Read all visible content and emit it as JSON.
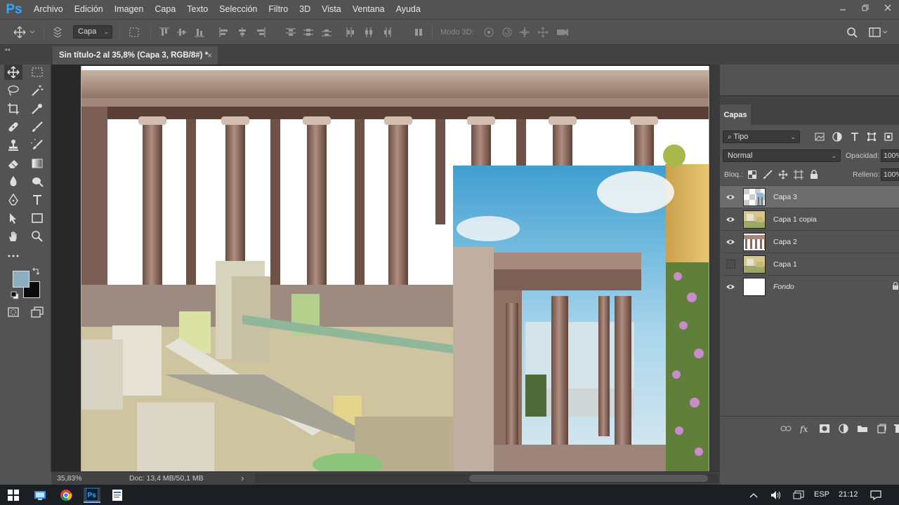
{
  "app": {
    "logo": "Ps",
    "menu": [
      "Archivo",
      "Edición",
      "Imagen",
      "Capa",
      "Texto",
      "Selección",
      "Filtro",
      "3D",
      "Vista",
      "Ventana",
      "Ayuda"
    ]
  },
  "options_bar": {
    "auto_select_target": "Capa",
    "mode_3d_label": "Modo 3D:"
  },
  "document": {
    "tab_title": "Sin título-2 al 35,8% (Capa 3, RGB/8#) *",
    "close_symbol": "×"
  },
  "status": {
    "zoom": "35,83%",
    "doc_size": "Doc: 13,4 MB/50,1 MB",
    "arrow": "›"
  },
  "colors": {
    "foreground": "#8cadc0",
    "background": "#0a0a0a",
    "accent": "#31a8ff"
  },
  "layers_panel": {
    "tab_label": "Capas",
    "filter_label": "Tipo",
    "blend_mode": "Normal",
    "opacity_label": "Opacidad:",
    "opacity_value": "100%",
    "lock_label": "Bloq.:",
    "fill_label": "Relleno:",
    "fill_value": "100%",
    "layers": [
      {
        "name": "Capa 3",
        "visible": true,
        "selected": true,
        "italic": false
      },
      {
        "name": "Capa 1 copia",
        "visible": true,
        "selected": false,
        "italic": false
      },
      {
        "name": "Capa 2",
        "visible": true,
        "selected": false,
        "italic": false
      },
      {
        "name": "Capa 1",
        "visible": false,
        "selected": false,
        "italic": false
      },
      {
        "name": "Fondo",
        "visible": true,
        "selected": false,
        "italic": true
      }
    ]
  },
  "taskbar": {
    "language": "ESP",
    "time": "21:12",
    "apps": [
      "file-explorer-icon",
      "chrome-icon",
      "photoshop-icon",
      "notes-icon"
    ]
  }
}
